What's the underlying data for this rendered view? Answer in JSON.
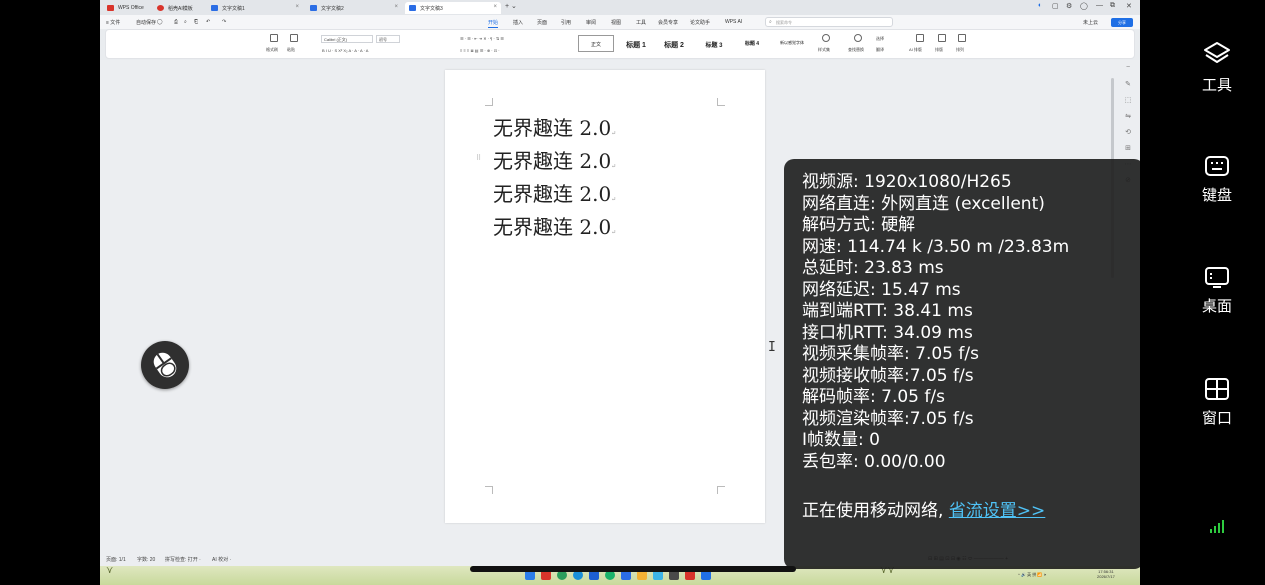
{
  "wps": {
    "tabs": [
      {
        "label": "WPS Office",
        "color": "#d9342b"
      },
      {
        "label": "稻壳AI模板",
        "color": "#d9342b"
      },
      {
        "label": "文字文稿1",
        "color": "#2b6de5"
      },
      {
        "label": "文字文稿2",
        "color": "#2b6de5"
      },
      {
        "label": "文字文稿3",
        "color": "#2b6de5"
      }
    ],
    "new_tab": "+ ⌄",
    "window_controls": [
      "◐",
      "▢",
      "⚙",
      "◯",
      "—",
      "⧉",
      "✕"
    ],
    "menu_left": [
      "≡ 文件",
      "自动保存",
      "◯",
      "⎙",
      "⌕",
      "⎗",
      "↶",
      "↷"
    ],
    "menu": [
      "开始",
      "插入",
      "页面",
      "引用",
      "审阅",
      "视图",
      "工具",
      "会员专享",
      "论文助手",
      "WPS AI"
    ],
    "active_menu": "开始",
    "command_search_placeholder": "搜索命令",
    "collab_label": "未上云",
    "share_label": "分享",
    "ribbon": {
      "clipboard": [
        "格式刷",
        "粘贴"
      ],
      "font_name": "Calibri (正文)",
      "font_size": "初号",
      "font_row2": "B  I  U  ·  S  X²  X₂  A  ·  A  ·  A  ·  A",
      "para_row1": "☰ · ☰ · ⇤ ⇥ ✕ · ¶ · ⇅ ☰",
      "para_row2": "≡ ≡ ≡ ≣ ▤ ☰ · ⊕ · ⊡ ·",
      "styles": [
        "正文",
        "标题 1",
        "标题 2",
        "标题 3",
        "标题 4",
        "新以感觉字体"
      ],
      "tools": [
        "样式集",
        "查找替换",
        "选择",
        "翻译",
        "AI 排版",
        "排版",
        "排列"
      ]
    },
    "document_lines": [
      "无界趣连 2.0",
      "无界趣连 2.0",
      "无界趣连 2.0",
      "无界趣连 2.0"
    ],
    "side_tools": [
      "−",
      "✎",
      "⬚",
      "⇋",
      "⟲",
      "⊞",
      "⋯",
      "⊘"
    ],
    "status": [
      "页面: 1/1",
      "字数: 20",
      "拼写检查: 打开 ·",
      "AI 校对 ·"
    ],
    "zoom_bar": "⊟ ⊞ ▤ ⊡ ⊟ ◉ ☷ ⬭ —————— +",
    "taskbar_tray": "^ 🔊 英 拼 📶 🕨",
    "time": "17:56:31",
    "date": "2026/7/17"
  },
  "stats": {
    "lines": [
      "视频源:  1920x1080/H265",
      "网络直连: 外网直连 (excellent)",
      "解码方式: 硬解",
      "网速: 114.74 k /3.50 m /23.83m",
      "总延时: 23.83 ms",
      "网络延迟: 15.47 ms",
      "端到端RTT: 38.41 ms",
      "接口机RTT: 34.09 ms",
      "视频采集帧率: 7.05 f/s",
      "视频接收帧率:7.05 f/s",
      "解码帧率: 7.05 f/s",
      "视频渲染帧率:7.05 f/s",
      "I帧数量: 0",
      "丢包率: 0.00/0.00"
    ],
    "network_notice": "正在使用移动网络,",
    "network_link": "省流设置>>"
  },
  "sidebar": {
    "items": [
      {
        "label": "工具",
        "icon": "layers-icon"
      },
      {
        "label": "键盘",
        "icon": "keyboard-icon"
      },
      {
        "label": "桌面",
        "icon": "desktop-icon"
      },
      {
        "label": "窗口",
        "icon": "window-grid-icon"
      }
    ],
    "signal_color": "#2ecc40"
  },
  "colors": {
    "accent": "#1f6fe5",
    "overlay_bg": "#1c1c1c",
    "link": "#4fc3f7"
  }
}
